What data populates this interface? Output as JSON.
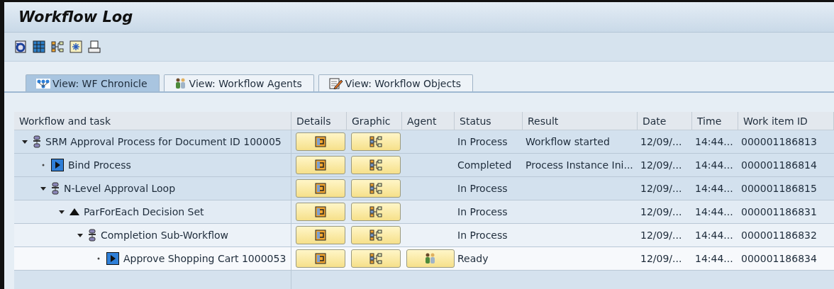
{
  "window": {
    "title": "Workflow Log"
  },
  "toolbar": [
    {
      "kind": "refresh"
    },
    {
      "kind": "columns"
    },
    {
      "kind": "hierarchy"
    },
    {
      "kind": "select"
    },
    {
      "kind": "print"
    }
  ],
  "tabs": [
    {
      "label": "View: WF Chronicle",
      "kind": "chronicle",
      "selected": true
    },
    {
      "label": "View: Workflow Agents",
      "kind": "agents",
      "selected": false
    },
    {
      "label": "View: Workflow Objects",
      "kind": "objects",
      "selected": false
    }
  ],
  "table": {
    "columns": [
      "Workflow and task",
      "Details",
      "Graphic",
      "Agent",
      "Status",
      "Result",
      "Date",
      "Time",
      "Work item ID"
    ],
    "rows": [
      {
        "name": "SRM Approval Process for Document ID 100005",
        "kind": "workflow",
        "expanded": true,
        "agent": false,
        "status": "In Process",
        "result": "Workflow started",
        "date": "12/09/...",
        "time": "14:44...",
        "id": "000001186813",
        "children": [
          {
            "name": "Bind Process",
            "kind": "task",
            "agent": false,
            "status": "Completed",
            "result": "Process Instance Ini...",
            "date": "12/09/...",
            "time": "14:44...",
            "id": "000001186814"
          },
          {
            "name": "N-Level Approval Loop",
            "kind": "workflow",
            "expanded": true,
            "agent": false,
            "status": "In Process",
            "date": "12/09/...",
            "time": "14:44...",
            "id": "000001186815",
            "children": [
              {
                "name": "ParForEach Decision Set",
                "kind": "fork",
                "expanded": true,
                "agent": false,
                "status": "In Process",
                "date": "12/09/...",
                "time": "14:44...",
                "id": "000001186831",
                "children": [
                  {
                    "name": "Completion Sub-Workflow",
                    "kind": "workflow",
                    "expanded": true,
                    "agent": false,
                    "status": "In Process",
                    "date": "12/09/...",
                    "time": "14:44...",
                    "id": "000001186832",
                    "children": [
                      {
                        "name": "Approve Shopping Cart 1000053",
                        "kind": "task",
                        "agent": true,
                        "status": "Ready",
                        "date": "12/09/...",
                        "time": "14:44...",
                        "id": "000001186834"
                      }
                    ]
                  }
                ]
              }
            ]
          }
        ]
      }
    ]
  }
}
